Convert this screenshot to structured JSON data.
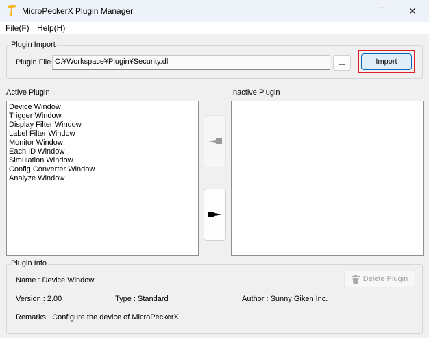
{
  "window": {
    "title": "MicroPeckerX Plugin Manager",
    "minimize": "—",
    "maximize": "☐",
    "close": "✕",
    "icon": "woodpecker-logo-icon"
  },
  "menu": {
    "file": "File(F)",
    "help": "Help(H)"
  },
  "plugin_import": {
    "group_label": "Plugin Import",
    "file_label": "Plugin File",
    "file_value": "C:¥Workspace¥Plugin¥Security.dll",
    "browse_label": "...",
    "import_label": "Import",
    "highlight_color": "#d9202a"
  },
  "active": {
    "label": "Active Plugin",
    "items": [
      "Device Window",
      "Trigger Window",
      "Display Filter Window",
      "Label Filter Window",
      "Monitor Window",
      "Each ID Window",
      "Simulation Window",
      "Config Converter Window",
      "Analyze Window"
    ]
  },
  "inactive": {
    "label": "Inactive Plugin",
    "items": []
  },
  "plugin_info": {
    "group_label": "Plugin Info",
    "name": "Name : Device Window",
    "version": "Version : 2.00",
    "type": "Type : Standard",
    "author": "Author : Sunny Giken Inc.",
    "remarks": "Remarks : Configure the device of MicroPeckerX.",
    "delete_label": "Delete Plugin"
  }
}
